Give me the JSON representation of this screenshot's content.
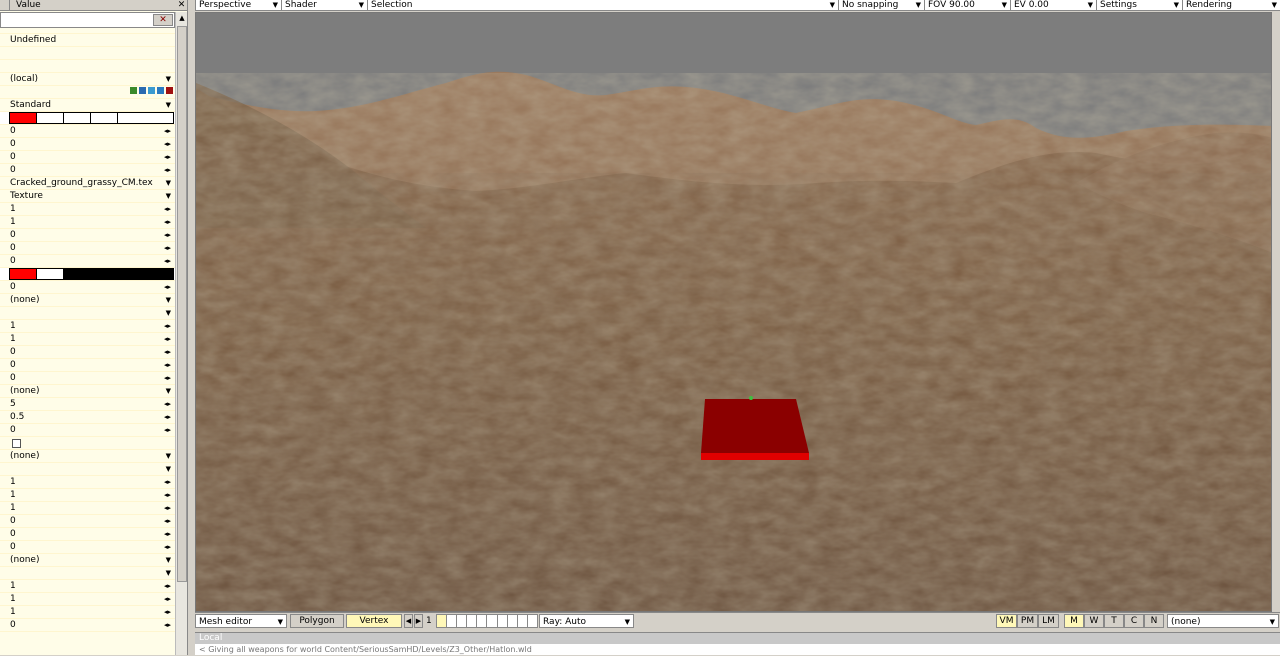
{
  "left_panel": {
    "header_value": "Value",
    "rows": [
      "Undefined",
      "",
      "(local)",
      "",
      "Standard",
      "",
      "0",
      "0",
      "0",
      "0",
      "Cracked_ground_grassy_CM.tex",
      "Texture",
      "1",
      "1",
      "0",
      "0",
      "0",
      "",
      "0",
      "(none)",
      "",
      "1",
      "1",
      "0",
      "0",
      "0",
      "(none)",
      "5",
      "0.5",
      "0",
      "",
      "(none)",
      "",
      "1",
      "1",
      "1",
      "0",
      "0",
      "0",
      "(none)",
      "",
      "1",
      "1",
      "1",
      "0"
    ]
  },
  "toolbar": {
    "view": "Perspective",
    "shader": "Shader",
    "selection": "Selection",
    "snapping": "No snapping",
    "fov": "FOV 90.00",
    "ev": "EV  0.00",
    "settings": "Settings",
    "rendering": "Rendering"
  },
  "bottom_bar": {
    "mode": "Mesh editor",
    "polygon": "Polygon",
    "vertex": "Vertex",
    "page": "1",
    "ray": "Ray: Auto",
    "vm": "VM",
    "pm": "PM",
    "lm": "LM",
    "m": "M",
    "w": "W",
    "t": "T",
    "c": "C",
    "n": "N",
    "filter": "(none)"
  },
  "console": {
    "title": "Local",
    "line": "< Giving all weapons for world Content/SeriousSamHD/Levels/Z3_Other/Hatlon.wld"
  },
  "colors": {
    "sky": "#7d7d7d",
    "ground": "#8b6a4e",
    "selection_box": "#8b0000",
    "accent_red": "#ff0000"
  }
}
